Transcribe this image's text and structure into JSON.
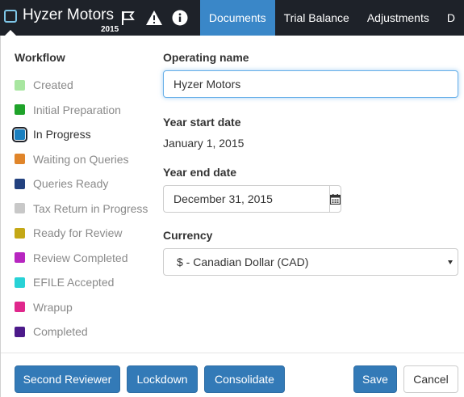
{
  "header": {
    "company_name": "Hyzer Motors",
    "year": "2015",
    "status_color": "#1a7fbf",
    "icons": [
      "flag-icon",
      "warning-icon",
      "info-icon"
    ],
    "tabs": [
      {
        "label": "Documents",
        "active": true
      },
      {
        "label": "Trial Balance",
        "active": false
      },
      {
        "label": "Adjustments",
        "active": false
      },
      {
        "label": "D",
        "active": false
      }
    ]
  },
  "workflow": {
    "title": "Workflow",
    "items": [
      {
        "label": "Created",
        "color": "#a8e6a0"
      },
      {
        "label": "Initial Preparation",
        "color": "#1fa32a"
      },
      {
        "label": "In Progress",
        "color": "#1a7fbf",
        "current": true
      },
      {
        "label": "Waiting on Queries",
        "color": "#e0852a"
      },
      {
        "label": "Queries Ready",
        "color": "#22417f"
      },
      {
        "label": "Tax Return in Progress",
        "color": "#c8c8c8"
      },
      {
        "label": "Ready for Review",
        "color": "#c4a816"
      },
      {
        "label": "Review Completed",
        "color": "#b726c0"
      },
      {
        "label": "EFILE Accepted",
        "color": "#28d2d6"
      },
      {
        "label": "Wrapup",
        "color": "#e0278c"
      },
      {
        "label": "Completed",
        "color": "#4c1a8a"
      }
    ]
  },
  "form": {
    "operating_name_label": "Operating name",
    "operating_name_value": "Hyzer Motors",
    "year_start_label": "Year start date",
    "year_start_value": "January 1, 2015",
    "year_end_label": "Year end date",
    "year_end_value": "December 31, 2015",
    "currency_label": "Currency",
    "currency_value": "$ - Canadian Dollar (CAD)"
  },
  "footer": {
    "second_reviewer": "Second Reviewer",
    "lockdown": "Lockdown",
    "consolidate": "Consolidate",
    "save": "Save",
    "cancel": "Cancel"
  }
}
